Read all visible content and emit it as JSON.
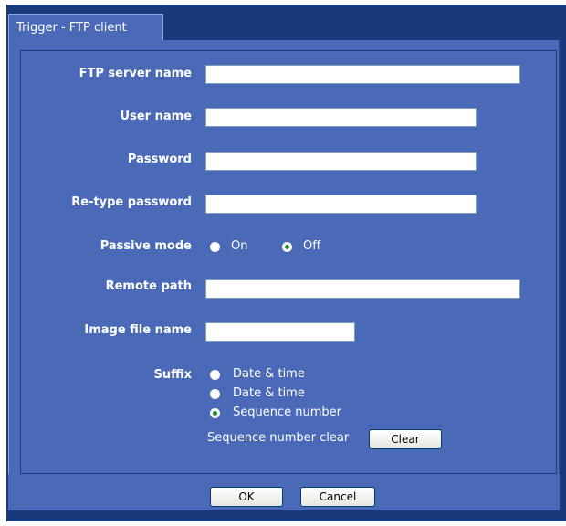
{
  "tab": {
    "label": "Trigger - FTP client"
  },
  "form": {
    "ftp_server_name": {
      "label": "FTP server name",
      "value": ""
    },
    "user_name": {
      "label": "User name",
      "value": ""
    },
    "password": {
      "label": "Password",
      "value": ""
    },
    "retype_password": {
      "label": "Re-type password",
      "value": ""
    },
    "passive_mode": {
      "label": "Passive mode",
      "options": [
        {
          "label": "On",
          "checked": false
        },
        {
          "label": "Off",
          "checked": true
        }
      ]
    },
    "remote_path": {
      "label": "Remote path",
      "value": ""
    },
    "image_file_name": {
      "label": "Image file name",
      "value": ""
    },
    "suffix": {
      "label": "Suffix",
      "options": [
        {
          "label": "Date & time",
          "checked": false
        },
        {
          "label": "Date & time",
          "checked": false
        },
        {
          "label": "Sequence number",
          "checked": true
        }
      ]
    },
    "sequence_number_clear": {
      "label": "Sequence number clear",
      "button": "Clear"
    }
  },
  "buttons": {
    "ok": "OK",
    "cancel": "Cancel"
  },
  "colors": {
    "frame": "#173a7c",
    "panel": "#4a6ab7",
    "text": "#ffffff",
    "radio_checked_dot": "#1d8a2a"
  }
}
